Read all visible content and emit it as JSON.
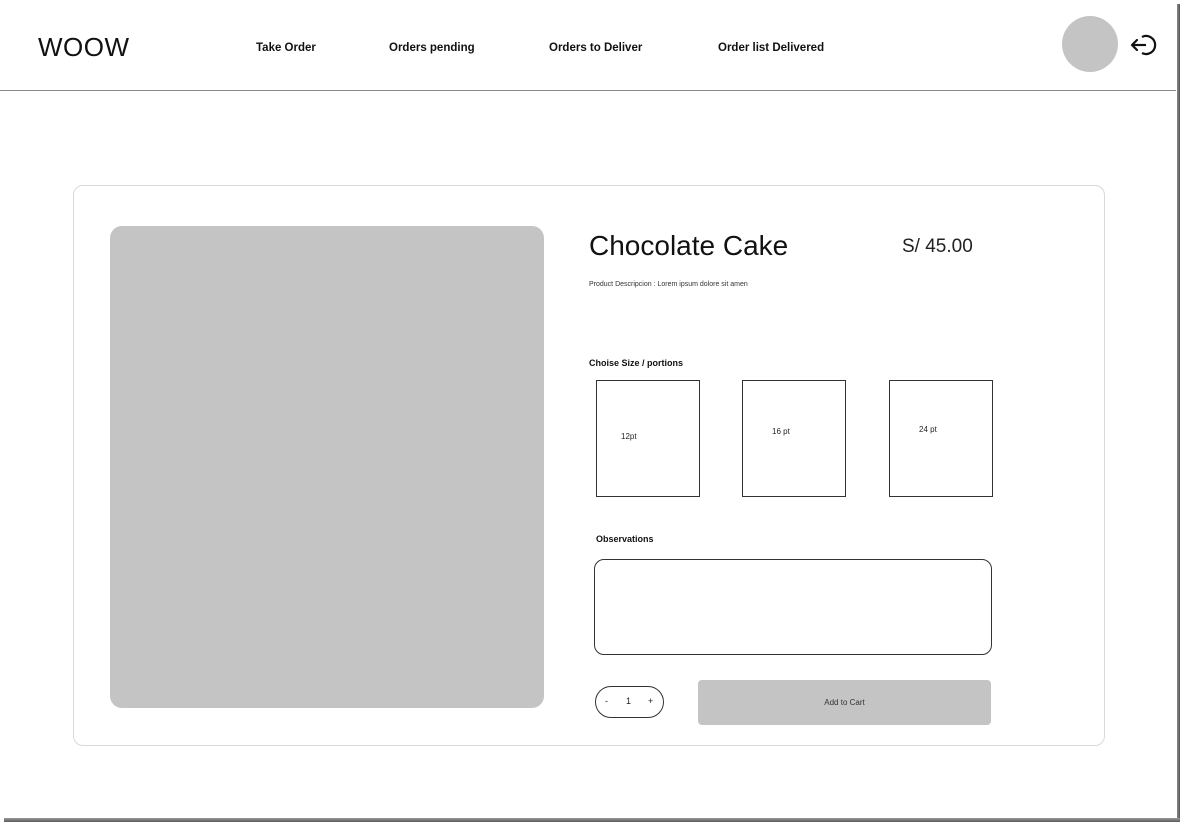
{
  "header": {
    "logo": "WOOW",
    "nav": [
      {
        "label": "Take Order"
      },
      {
        "label": "Orders pending"
      },
      {
        "label": "Orders to Deliver"
      },
      {
        "label": "Order list Delivered"
      }
    ],
    "avatar_icon": "avatar-placeholder",
    "logout_icon": "logout-arrow-icon"
  },
  "product": {
    "title": "Chocolate Cake",
    "price": "S/ 45.00",
    "description": "Product  Descripcion : Lorem ipsum dolore sit amen",
    "size_label": "Choise Size / portions",
    "sizes": [
      {
        "label": "12pt"
      },
      {
        "label": "16 pt"
      },
      {
        "label": "24 pt"
      }
    ],
    "observations_label": "Observations",
    "observations_value": "",
    "quantity": {
      "minus": "-",
      "value": "1",
      "plus": "+"
    },
    "add_to_cart_label": "Add to Cart"
  },
  "colors": {
    "placeholder_gray": "#c4c4c4",
    "border": "#333333",
    "card_border": "#d9d9d9"
  }
}
